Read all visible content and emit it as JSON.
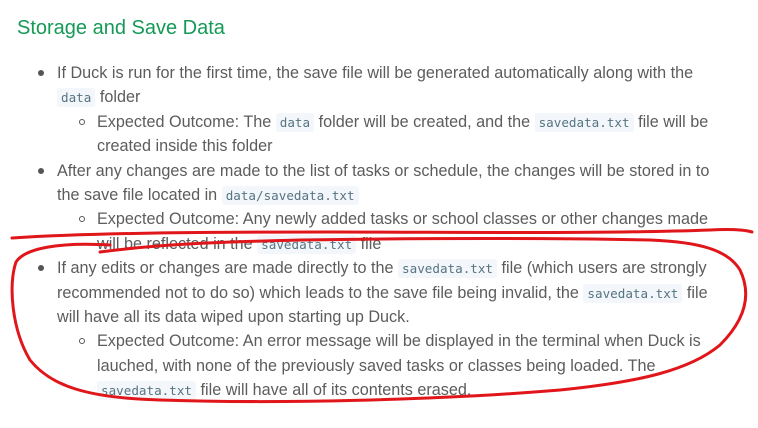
{
  "heading": "Storage and Save Data",
  "items": [
    {
      "lines": [
        [
          "If Duck is run for the first time, the save file will be generated automatically along with the"
        ],
        [
          {
            "code": "data"
          },
          " folder"
        ]
      ],
      "sub": {
        "lines": [
          [
            "Expected Outcome: The ",
            {
              "code": "data"
            },
            " folder will be created, and the ",
            {
              "code": "savedata.txt"
            },
            " file will be"
          ],
          [
            "created inside this folder"
          ]
        ]
      }
    },
    {
      "lines": [
        [
          "After any changes are made to the list of tasks or schedule, the changes will be stored in to"
        ],
        [
          "the save file located in ",
          {
            "code": "data/savedata.txt"
          }
        ]
      ],
      "sub": {
        "lines": [
          [
            "Expected Outcome: Any newly added tasks or school classes or other changes made"
          ],
          [
            "will be reflected in the ",
            {
              "code": "savedata.txt"
            },
            " file"
          ]
        ]
      }
    },
    {
      "lines": [
        [
          "If any edits or changes are made directly to the ",
          {
            "code": "savedata.txt"
          },
          " file (which users are strongly"
        ],
        [
          "recommended not to do so) which leads to the save file being invalid, the ",
          {
            "code": "savedata.txt"
          },
          " file"
        ],
        [
          "will have all its data wiped upon starting up Duck."
        ]
      ],
      "sub": {
        "lines": [
          [
            "Expected Outcome: An error message will be displayed in the terminal when Duck is"
          ],
          [
            "lauched, with none of the previously saved tasks or classes being loaded. The"
          ],
          [
            {
              "code": "savedata.txt"
            },
            " file will have all of its contents erased."
          ]
        ]
      }
    }
  ],
  "annotation_color": "#e0161b"
}
